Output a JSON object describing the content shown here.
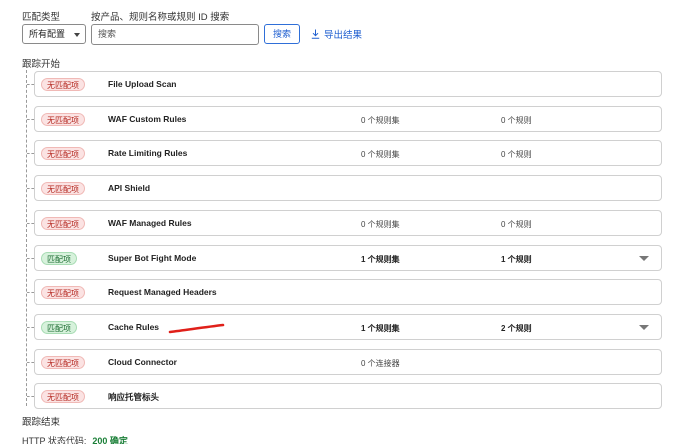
{
  "filter": {
    "type_label": "匹配类型",
    "type_value": "所有配置",
    "search_label": "按产品、规则名称或规则 ID 搜索",
    "search_placeholder": "搜索",
    "search_button": "搜索",
    "export_label": "导出结果"
  },
  "trace": {
    "start_label": "跟踪开始",
    "end_label": "跟踪结束",
    "rows": [
      {
        "badge": "无匹配项",
        "matched": false,
        "name": "File Upload Scan",
        "col1": "",
        "col2": "",
        "expandable": false
      },
      {
        "badge": "无匹配项",
        "matched": false,
        "name": "WAF Custom Rules",
        "col1": "0 个规则集",
        "col2": "0 个规则",
        "expandable": false
      },
      {
        "badge": "无匹配项",
        "matched": false,
        "name": "Rate Limiting Rules",
        "col1": "0 个规则集",
        "col2": "0 个规则",
        "expandable": false
      },
      {
        "badge": "无匹配项",
        "matched": false,
        "name": "API Shield",
        "col1": "",
        "col2": "",
        "expandable": false
      },
      {
        "badge": "无匹配项",
        "matched": false,
        "name": "WAF Managed Rules",
        "col1": "0 个规则集",
        "col2": "0 个规则",
        "expandable": false
      },
      {
        "badge": "匹配项",
        "matched": true,
        "name": "Super Bot Fight Mode",
        "col1": "1 个规则集",
        "col2": "1 个规则",
        "expandable": true
      },
      {
        "badge": "无匹配项",
        "matched": false,
        "name": "Request Managed Headers",
        "col1": "",
        "col2": "",
        "expandable": false
      },
      {
        "badge": "匹配项",
        "matched": true,
        "name": "Cache Rules",
        "col1": "1 个规则集",
        "col2": "2 个规则",
        "expandable": true
      },
      {
        "badge": "无匹配项",
        "matched": false,
        "name": "Cloud Connector",
        "col1": "0 个连接器",
        "col2": "",
        "expandable": false
      },
      {
        "badge": "无匹配项",
        "matched": false,
        "name": "响应托管标头",
        "col1": "",
        "col2": "",
        "expandable": false
      }
    ]
  },
  "status": {
    "label": "HTTP 状态代码:",
    "code": "200 确定"
  },
  "colors": {
    "accent": "#1f5fd0",
    "match_bg": "#d7f2dc",
    "nomatch_bg": "#fbe3e3",
    "annotation_red": "#e0201a"
  },
  "icons": {
    "export": "download-icon",
    "expand": "chevron-down-icon"
  }
}
